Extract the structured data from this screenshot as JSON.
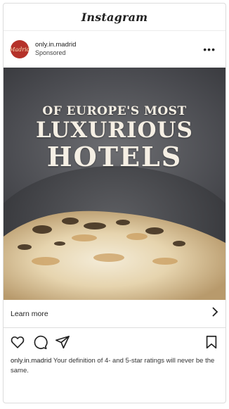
{
  "app": {
    "logo_text": "Instagram"
  },
  "post": {
    "avatar_text": "Madrid",
    "account_name": "only.in.madrid",
    "sponsored_label": "Sponsored",
    "more_icon": "more-dots-icon",
    "headline": {
      "line1": "OF EUROPE'S MOST",
      "line2": "LUXURIOUS",
      "line3": "HOTELS"
    },
    "cta_label": "Learn more",
    "cta_icon": "chevron-right-icon",
    "actions": {
      "like_icon": "heart-icon",
      "comment_icon": "comment-icon",
      "share_icon": "send-icon",
      "save_icon": "bookmark-icon"
    },
    "caption": {
      "user": "only.in.madrid",
      "text": "Your definition of 4- and 5-star ratings will never be the same."
    }
  },
  "colors": {
    "avatar_bg": "#b5322a",
    "headline_text": "#f5efe4"
  }
}
